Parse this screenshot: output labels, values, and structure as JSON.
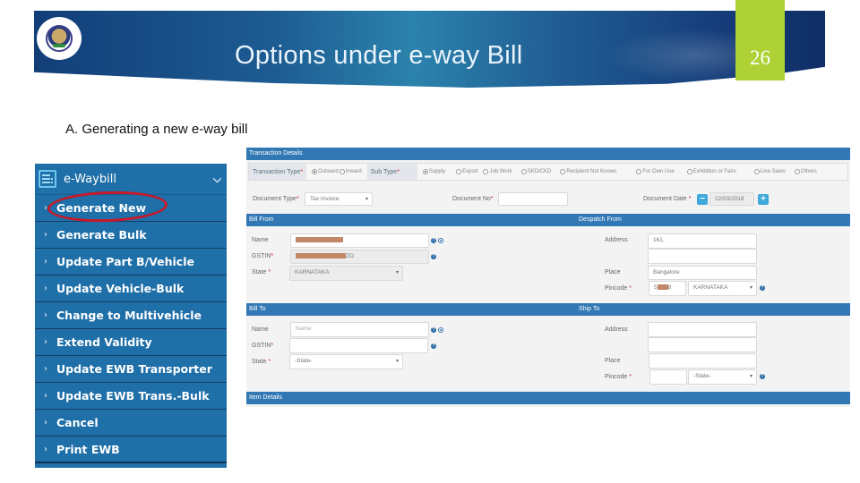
{
  "slide": {
    "title": "Options under e-way Bill",
    "page_number": "26",
    "subheading": "A. Generating a new e-way bill",
    "colors": {
      "banner": "#1d5b92",
      "page_badge": "#aed136",
      "sidebar": "#1f6fa8",
      "form_bar": "#3178b5",
      "highlight": "#c6192a"
    }
  },
  "sidebar": {
    "title": "e-Waybill",
    "icon": "document-list-icon",
    "expand_icon": "chevron-down-icon",
    "items": [
      {
        "label": "Generate New",
        "highlighted": true
      },
      {
        "label": "Generate Bulk"
      },
      {
        "label": "Update Part B/Vehicle"
      },
      {
        "label": "Update Vehicle-Bulk"
      },
      {
        "label": "Change to Multivehicle"
      },
      {
        "label": "Extend Validity"
      },
      {
        "label": "Update EWB Transporter"
      },
      {
        "label": "Update EWB Trans.-Bulk"
      },
      {
        "label": "Cancel"
      },
      {
        "label": "Print EWB"
      }
    ]
  },
  "form": {
    "transaction_details": {
      "header": "Transaction Details",
      "transaction_type_label": "Transaction Type",
      "transaction_types": [
        {
          "label": "Outward",
          "selected": true
        },
        {
          "label": "Inward",
          "selected": false
        }
      ],
      "sub_type_label": "Sub Type",
      "sub_types": [
        {
          "label": "Supply",
          "selected": true
        },
        {
          "label": "Export",
          "selected": false
        },
        {
          "label": "Job Work",
          "selected": false
        },
        {
          "label": "SKD/CKD",
          "selected": false
        },
        {
          "label": "Recipient Not Known",
          "selected": false
        },
        {
          "label": "For Own Use",
          "selected": false
        },
        {
          "label": "Exhibition or Fairs",
          "selected": false
        },
        {
          "label": "Line Sales",
          "selected": false
        },
        {
          "label": "Others",
          "selected": false
        }
      ],
      "document_type_label": "Document Type",
      "document_type_value": "Tax Invoice",
      "document_no_label": "Document No",
      "document_no_value": "",
      "document_date_label": "Document Date",
      "document_date_value": "22/03/2018"
    },
    "bill_from": {
      "header": "Bill From",
      "name_label": "Name",
      "gstin_label": "GSTIN",
      "gstin_suffix": "ZO",
      "state_label": "State",
      "state_value": "KARNATAKA"
    },
    "despatch_from": {
      "header": "Despatch From",
      "address_label": "Address",
      "address_line1": "161,",
      "address_line2": "",
      "place_label": "Place",
      "place_value": "Bangalore",
      "pincode_label": "Pincode",
      "pincode_prefix": "5",
      "pincode_suffix": "8",
      "state_value": "KARNATAKA"
    },
    "bill_to": {
      "header": "Bill To",
      "name_label": "Name",
      "name_placeholder": "Name",
      "gstin_label": "GSTIN",
      "state_label": "State",
      "state_value": "-State-"
    },
    "ship_to": {
      "header": "Ship To",
      "address_label": "Address",
      "place_label": "Place",
      "pincode_label": "Pincode",
      "state_value": "-State-"
    },
    "item_details": {
      "header": "Item Details"
    },
    "required_marker": "*"
  }
}
